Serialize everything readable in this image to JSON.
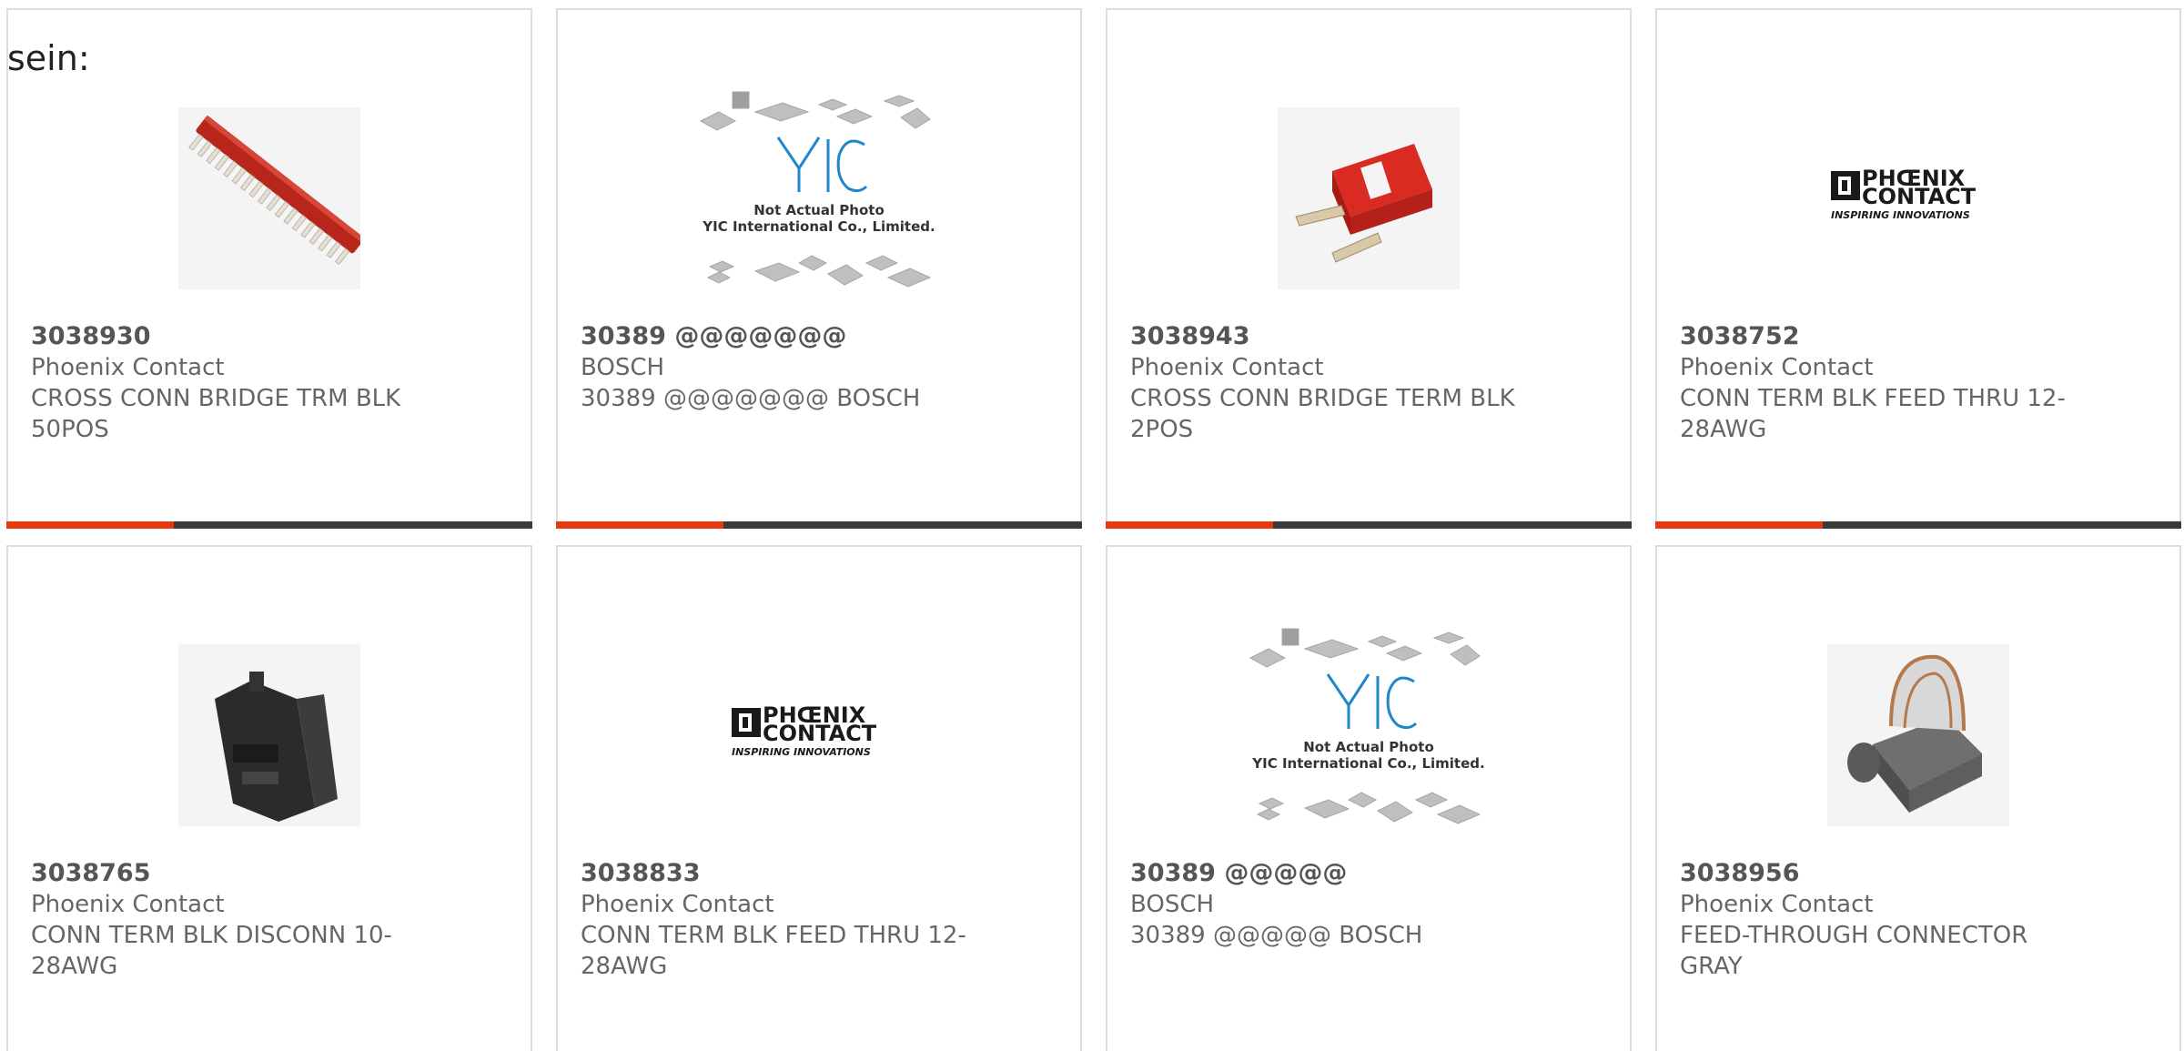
{
  "lead_text": "sein:",
  "accent_color": "#e8380f",
  "bar_color": "#3a3a3a",
  "products": [
    {
      "part": "3038930",
      "maker": "Phoenix Contact",
      "desc": "CROSS CONN BRIDGE TRM BLK 50POS",
      "image": "red-bridge-50pos"
    },
    {
      "part": "30389 @@@@@@@",
      "maker": "BOSCH",
      "desc": "30389 @@@@@@@ BOSCH",
      "image": "yic-placeholder",
      "placeholder": {
        "line1": "Not Actual Photo",
        "line2": "YIC International Co., Limited."
      }
    },
    {
      "part": "3038943",
      "maker": "Phoenix Contact",
      "desc": "CROSS CONN BRIDGE TERM BLK 2POS",
      "image": "red-bridge-2pos"
    },
    {
      "part": "3038752",
      "maker": "Phoenix Contact",
      "desc": "CONN TERM BLK FEED THRU 12-28AWG",
      "image": "phoenix-logo",
      "logo": {
        "line1": "PHŒNIX",
        "line2": "CONTACT",
        "tagline": "INSPIRING INNOVATIONS"
      }
    },
    {
      "part": "3038765",
      "maker": "Phoenix Contact",
      "desc": "CONN TERM BLK DISCONN 10-28AWG",
      "image": "black-terminal-block"
    },
    {
      "part": "3038833",
      "maker": "Phoenix Contact",
      "desc": "CONN TERM BLK FEED THRU 12-28AWG",
      "image": "phoenix-logo",
      "logo": {
        "line1": "PHŒNIX",
        "line2": "CONTACT",
        "tagline": "INSPIRING INNOVATIONS"
      }
    },
    {
      "part": "30389 @@@@@",
      "maker": "BOSCH",
      "desc": "30389 @@@@@ BOSCH",
      "image": "yic-placeholder",
      "placeholder": {
        "line1": "Not Actual Photo",
        "line2": "YIC International Co., Limited."
      }
    },
    {
      "part": "3038956",
      "maker": "Phoenix Contact",
      "desc": "FEED-THROUGH CONNECTOR GRAY",
      "image": "gray-feedthrough-connector"
    }
  ]
}
